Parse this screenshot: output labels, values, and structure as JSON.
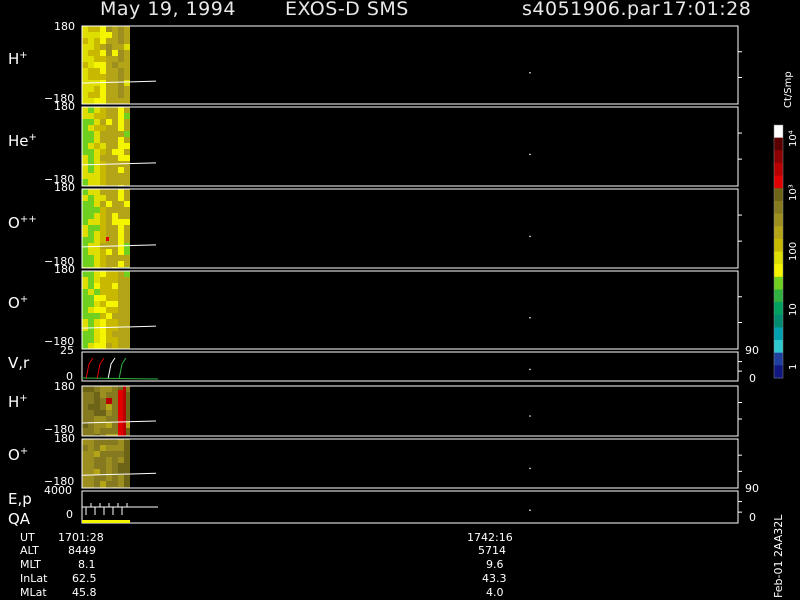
{
  "header": {
    "date": "May 19, 1994",
    "instrument": "EXOS-D SMS",
    "file": "s4051906.par",
    "time": "17:01:28"
  },
  "panels": [
    {
      "id": "hplus1",
      "species": "H",
      "charge": "+",
      "y_top": "180",
      "y_bottom": "−180"
    },
    {
      "id": "heplus",
      "species": "He",
      "charge": "+",
      "y_top": "180",
      "y_bottom": "−180"
    },
    {
      "id": "oplusplus",
      "species": "O",
      "charge": "++",
      "y_top": "180",
      "y_bottom": "−180"
    },
    {
      "id": "oplus1",
      "species": "O",
      "charge": "+",
      "y_top": "180",
      "y_bottom": "−180"
    },
    {
      "id": "vr",
      "species": "V,r",
      "charge": "",
      "y_top": "25",
      "y_bottom": "0",
      "right_top": "90",
      "right_bottom": "0"
    },
    {
      "id": "hplus2",
      "species": "H",
      "charge": "+",
      "y_top": "180",
      "y_bottom": "−180"
    },
    {
      "id": "oplus2",
      "species": "O",
      "charge": "+",
      "y_top": "180",
      "y_bottom": "−180"
    },
    {
      "id": "ep",
      "species": "E,p",
      "species2": "QA",
      "charge": "",
      "y_top": "4000",
      "y_bottom": "0",
      "right_top": "90",
      "right_bottom": "0"
    }
  ],
  "colorbar": {
    "unit": "Ct/Smp",
    "tick_labels": [
      "10⁴",
      "10³",
      "100",
      "10",
      "1"
    ],
    "colors": [
      "#ffffff",
      "#5a0000",
      "#8b0000",
      "#b80000",
      "#e00000",
      "#6e6418",
      "#857a20",
      "#9c8f20",
      "#b3a418",
      "#c8b800",
      "#dede00",
      "#f5f500",
      "#70d020",
      "#30b040",
      "#00a060",
      "#008a70",
      "#00a0b0",
      "#30c8d0",
      "#2040a0",
      "#101880"
    ]
  },
  "chart_data": {
    "type": "heatmap",
    "title": "May 19, 1994   EXOS-D SMS",
    "x_axis_ticks": [
      "1701:28",
      "1742:16"
    ],
    "series": [
      {
        "name": "H+",
        "y_range": [
          -180,
          180
        ]
      },
      {
        "name": "He+",
        "y_range": [
          -180,
          180
        ]
      },
      {
        "name": "O++",
        "y_range": [
          -180,
          180
        ]
      },
      {
        "name": "O+",
        "y_range": [
          -180,
          180
        ]
      },
      {
        "name": "V,r",
        "y_range": [
          0,
          25
        ]
      },
      {
        "name": "H+",
        "y_range": [
          -180,
          180
        ]
      },
      {
        "name": "O+",
        "y_range": [
          -180,
          180
        ]
      },
      {
        "name": "E,p / QA",
        "y_range": [
          0,
          4000
        ]
      }
    ],
    "colorbar_unit": "Ct/Smp",
    "colorbar_ticks": [
      "1",
      "10",
      "100",
      "10³",
      "10⁴"
    ]
  },
  "footer": {
    "rows": [
      {
        "label": "UT",
        "v1": "1701:28",
        "v2": "1742:16"
      },
      {
        "label": "ALT",
        "v1": "8449",
        "v2": "5714"
      },
      {
        "label": "MLT",
        "v1": "8.1",
        "v2": "9.6"
      },
      {
        "label": "InLat",
        "v1": "62.5",
        "v2": "43.3"
      },
      {
        "label": "MLat",
        "v1": "45.8",
        "v2": "4.0"
      }
    ],
    "side_note": "Feb-01 2AA32L"
  }
}
